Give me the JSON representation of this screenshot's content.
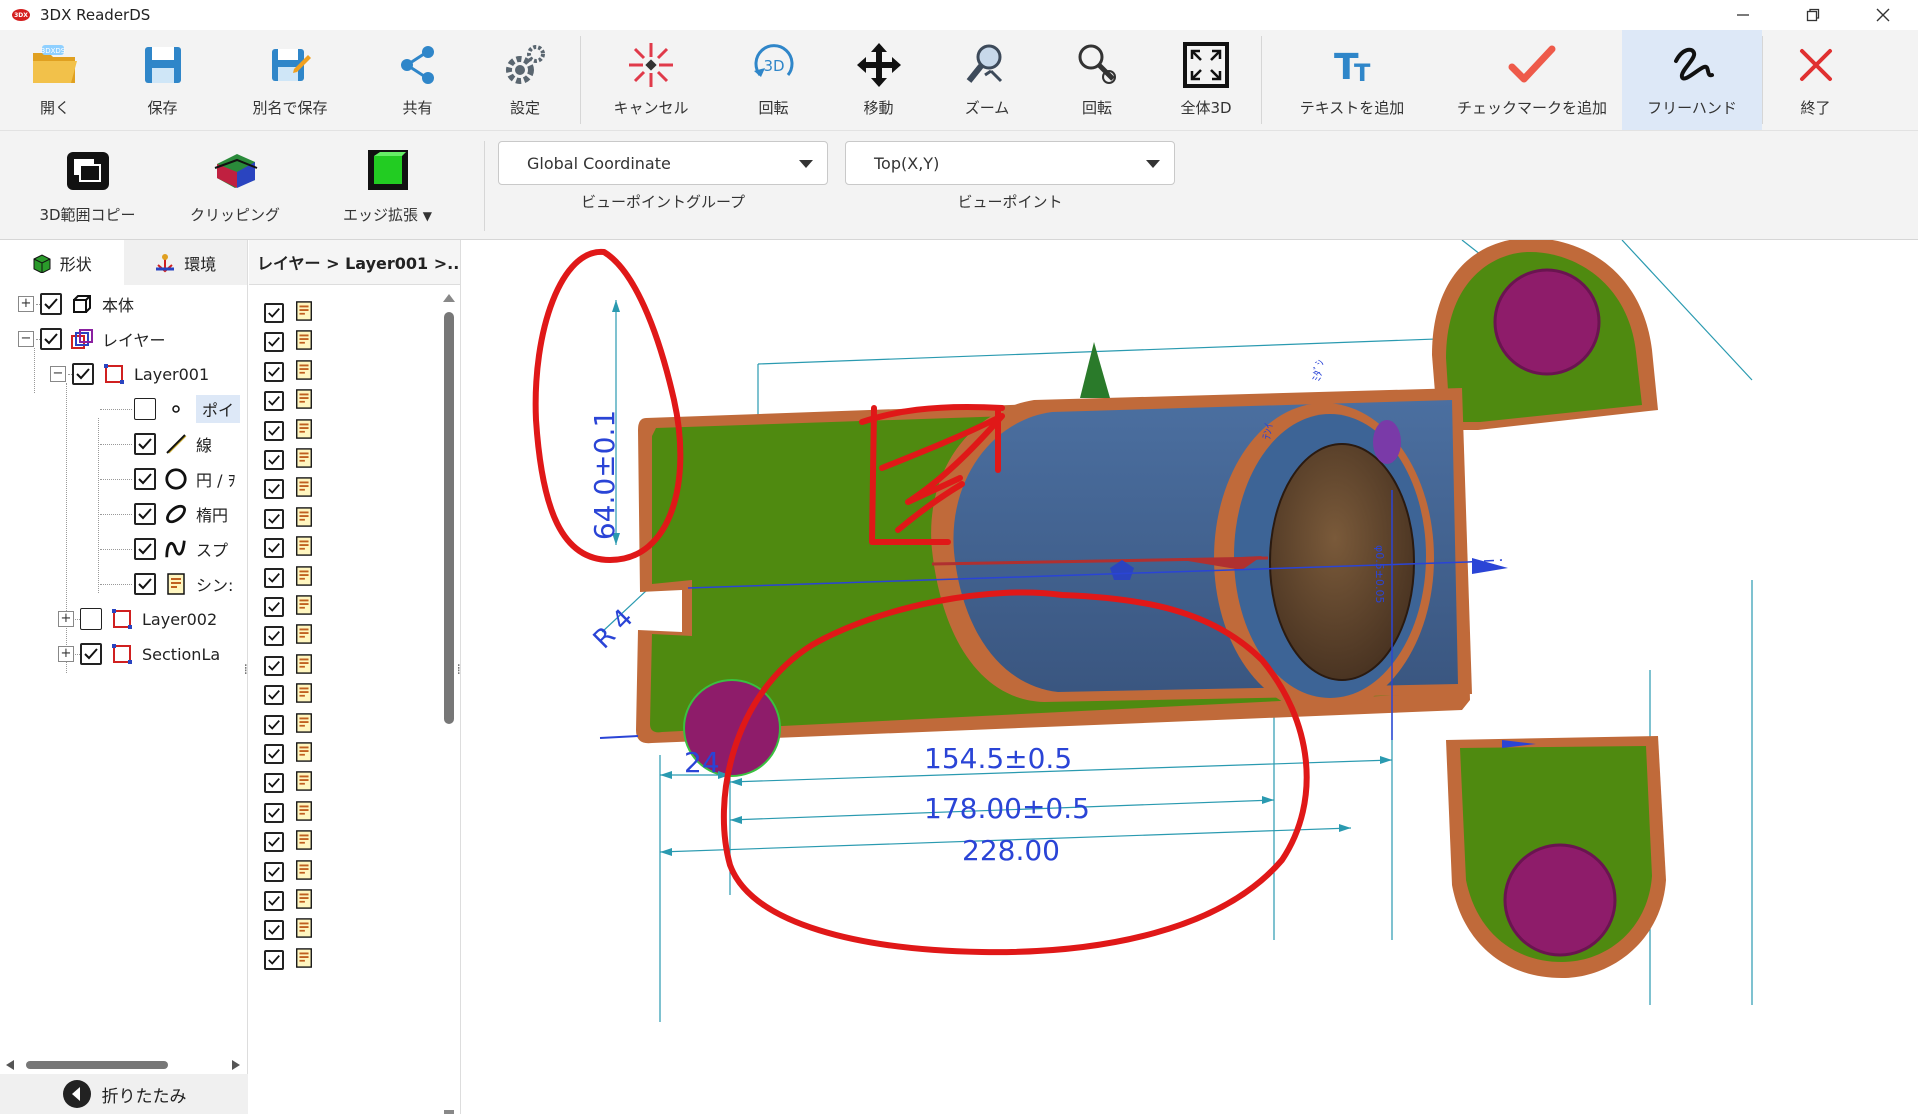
{
  "window": {
    "title": "3DX ReaderDS",
    "logo_text": "3DX"
  },
  "toolbar": {
    "items": [
      {
        "label": "開く",
        "icon": "folder-open-icon"
      },
      {
        "label": "保存",
        "icon": "save-icon"
      },
      {
        "label": "別名で保存",
        "icon": "save-as-icon"
      },
      {
        "label": "共有",
        "icon": "share-icon"
      },
      {
        "label": "設定",
        "icon": "gear-icon"
      },
      {
        "label": "キャンセル",
        "icon": "cancel-icon"
      },
      {
        "label": "回転",
        "icon": "rotate-3d-icon"
      },
      {
        "label": "移動",
        "icon": "move-icon"
      },
      {
        "label": "ズーム",
        "icon": "zoom-icon"
      },
      {
        "label": "回転",
        "icon": "rotate-icon"
      },
      {
        "label": "全体3D",
        "icon": "fit-all-icon"
      },
      {
        "label": "テキストを追加",
        "icon": "add-text-icon"
      },
      {
        "label": "チェックマークを追加",
        "icon": "add-checkmark-icon"
      },
      {
        "label": "フリーハンド",
        "icon": "freehand-icon",
        "active": true
      },
      {
        "label": "終了",
        "icon": "exit-icon"
      }
    ]
  },
  "ribbon2": {
    "copy_label": "3D範囲コピー",
    "clipping_label": "クリッピング",
    "edge_label": "エッジ拡張",
    "viewpoint_group_value": "Global Coordinate",
    "viewpoint_group_label": "ビューポイントグループ",
    "viewpoint_value": "Top(X,Y)",
    "viewpoint_label": "ビューポイント"
  },
  "left_panel": {
    "tabs": [
      {
        "label": "形状"
      },
      {
        "label": "環境"
      }
    ],
    "tree": {
      "body": "本体",
      "layers": "レイヤー",
      "layer001": "Layer001",
      "point": "ポイ",
      "line": "線",
      "circle": "円 / ｦ",
      "ellipse": "楕円",
      "spline": "スプ",
      "symbol": "シン:",
      "layer002": "Layer002",
      "section": "SectionLa"
    },
    "collapse_label": "折りたたみ"
  },
  "middle_panel": {
    "header": "レイヤー > Layer001 >...",
    "row_count": 23
  },
  "drawing": {
    "dims": {
      "d154": "154.5±0.5",
      "d178": "178.00±0.5",
      "d228": "228.00",
      "d24": "24",
      "d64": "64.0±0.1",
      "r4": "R 4"
    },
    "colors": {
      "green": "#4f8a10",
      "blue": "#3d6496",
      "copper": "#c06a3a",
      "purple": "#8e1c6a",
      "dim": "#2a44d6",
      "markup": "#e01818"
    }
  }
}
